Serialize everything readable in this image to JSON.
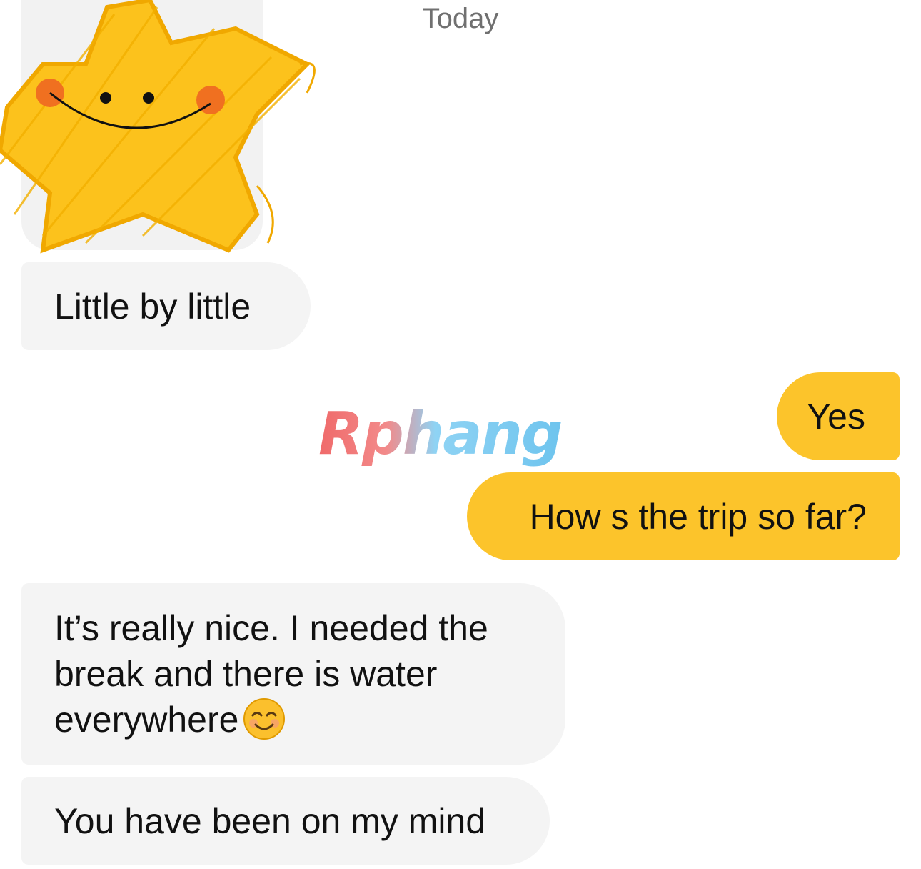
{
  "header": {
    "date_label": "Today"
  },
  "conversation": {
    "messages": [
      {
        "side": "incoming",
        "text": "Little by little"
      },
      {
        "side": "outgoing",
        "text": "Yes"
      },
      {
        "side": "outgoing",
        "text": "How s the trip so far?"
      },
      {
        "side": "incoming",
        "text_line1": "It’s really nice. I needed the",
        "text_line2": "break and there is water",
        "text_line3": "everywhere",
        "emoji": "smiling-face-icon"
      },
      {
        "side": "incoming",
        "text": "You have been on my mind"
      }
    ]
  },
  "overlay": {
    "sticker": "star-face-scribble",
    "watermark_text": "Rphang"
  },
  "colors": {
    "incoming_bubble": "#f4f4f4",
    "outgoing_bubble": "#fcc42b",
    "date_text": "#707070"
  }
}
